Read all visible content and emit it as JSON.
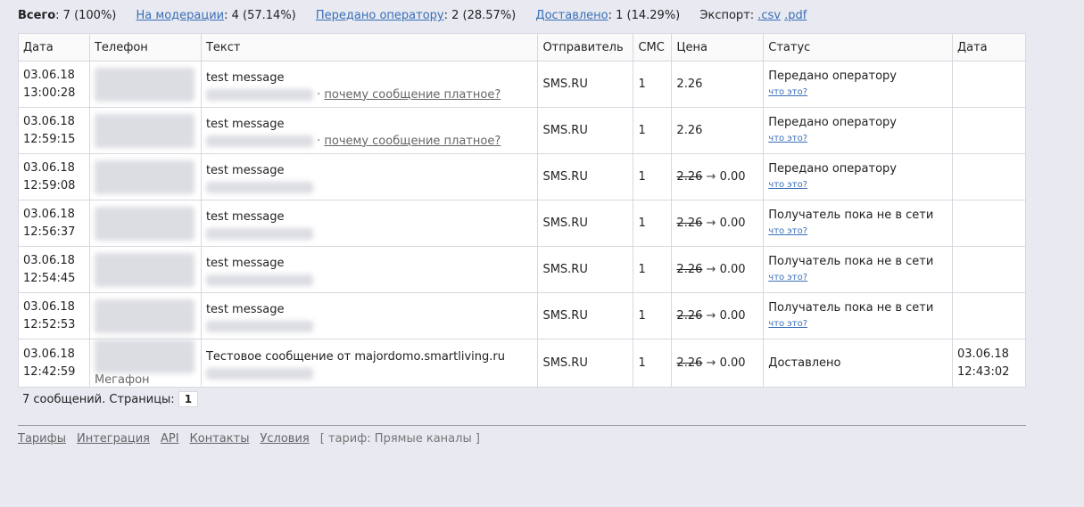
{
  "summary": {
    "total_label": "Всего",
    "total_value": ": 7 (100%)",
    "moderation_label": "На модерации",
    "moderation_value": ": 4 (57.14%)",
    "operator_label": "Передано оператору",
    "operator_value": ": 2 (28.57%)",
    "delivered_label": "Доставлено",
    "delivered_value": ": 1 (14.29%)",
    "export_label": "Экспорт:",
    "export_csv": ".csv",
    "export_pdf": ".pdf"
  },
  "table": {
    "headers": [
      "Дата",
      "Телефон",
      "Текст",
      "Отправитель",
      "СМС",
      "Цена",
      "Статус",
      "Дата"
    ],
    "paid_link": "почему сообщение платное?",
    "paid_sep": "·",
    "what_link": "что это?",
    "arrow": "→",
    "rows": [
      {
        "date": "03.06.18",
        "time": "13:00:28",
        "carrier": "",
        "text": "test message",
        "sender": "SMS.RU",
        "sms": "1",
        "price": "2.26",
        "old_price": "",
        "new_price": "",
        "status": "Передано оператору",
        "ddate": "",
        "dtime": ""
      },
      {
        "date": "03.06.18",
        "time": "12:59:15",
        "carrier": "",
        "text": "test message",
        "sender": "SMS.RU",
        "sms": "1",
        "price": "2.26",
        "old_price": "",
        "new_price": "",
        "status": "Передано оператору",
        "ddate": "",
        "dtime": ""
      },
      {
        "date": "03.06.18",
        "time": "12:59:08",
        "carrier": "",
        "text": "test message",
        "sender": "SMS.RU",
        "sms": "1",
        "price": "",
        "old_price": "2.26",
        "new_price": "0.00",
        "status": "Передано оператору",
        "ddate": "",
        "dtime": ""
      },
      {
        "date": "03.06.18",
        "time": "12:56:37",
        "carrier": "",
        "text": "test message",
        "sender": "SMS.RU",
        "sms": "1",
        "price": "",
        "old_price": "2.26",
        "new_price": "0.00",
        "status": "Получатель пока не в сети",
        "ddate": "",
        "dtime": ""
      },
      {
        "date": "03.06.18",
        "time": "12:54:45",
        "carrier": "",
        "text": "test message",
        "sender": "SMS.RU",
        "sms": "1",
        "price": "",
        "old_price": "2.26",
        "new_price": "0.00",
        "status": "Получатель пока не в сети",
        "ddate": "",
        "dtime": ""
      },
      {
        "date": "03.06.18",
        "time": "12:52:53",
        "carrier": "",
        "text": "test message",
        "sender": "SMS.RU",
        "sms": "1",
        "price": "",
        "old_price": "2.26",
        "new_price": "0.00",
        "status": "Получатель пока не в сети",
        "ddate": "",
        "dtime": ""
      },
      {
        "date": "03.06.18",
        "time": "12:42:59",
        "carrier": "Мегафон",
        "text": "Тестовое сообщение от majordomo.smartliving.ru",
        "sender": "SMS.RU",
        "sms": "1",
        "price": "",
        "old_price": "2.26",
        "new_price": "0.00",
        "status": "Доставлено",
        "ddate": "03.06.18",
        "dtime": "12:43:02"
      }
    ]
  },
  "pager": {
    "label": "7 сообщений. Страницы:",
    "current": "1"
  },
  "footer": {
    "links": [
      "Тарифы",
      "Интеграция",
      "API",
      "Контакты",
      "Условия"
    ],
    "tariff": "[ тариф: Прямые каналы ]"
  },
  "colors": {
    "link": "#3a6fb5",
    "background": "#e8e9f1"
  }
}
